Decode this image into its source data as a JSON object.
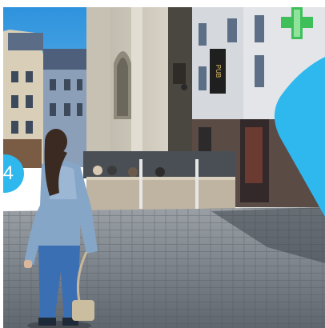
{
  "photo": {
    "subject": "woman-walking-in-town-square",
    "colors": {
      "sky": "#3a9ee0",
      "accent_shape": "#2fb8ee",
      "pharmacy_cross": "#3fbf5a",
      "pavement": "#6f7780",
      "jeans": "#3b6fb4",
      "sweater": "#86a6c8"
    }
  },
  "badge": {
    "number": "4",
    "color": "#2fb8ee"
  },
  "sign_text": "PUB"
}
